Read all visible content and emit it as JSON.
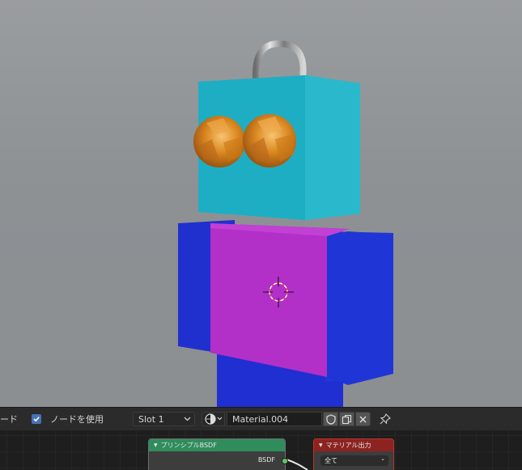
{
  "header": {
    "mode_label": "ード",
    "use_nodes_label": "ノードを使用",
    "slot_value": "Slot 1",
    "material_name": "Material.004"
  },
  "nodes": {
    "bsdf_title": "プリンシプルBSDF",
    "bsdf_output_socket": "BSDF",
    "output_title": "マテリアル出力",
    "output_target": "全て"
  },
  "icons": {
    "checkbox": "checkmark-icon",
    "browse": "material-sphere-icon",
    "fake_user": "shield-icon",
    "duplicate": "duplicate-icon",
    "unlink": "close-icon",
    "pin": "pin-icon",
    "cursor": "3d-cursor-icon"
  },
  "colors": {
    "head": "#22b4c8",
    "eyes": "#d98a1c",
    "torso_front": "#b02fc7",
    "torso_sides": "#2234d8",
    "checkbox": "#4772b3",
    "bsdf_header": "#2f8d5c",
    "output_header": "#8c2321"
  }
}
